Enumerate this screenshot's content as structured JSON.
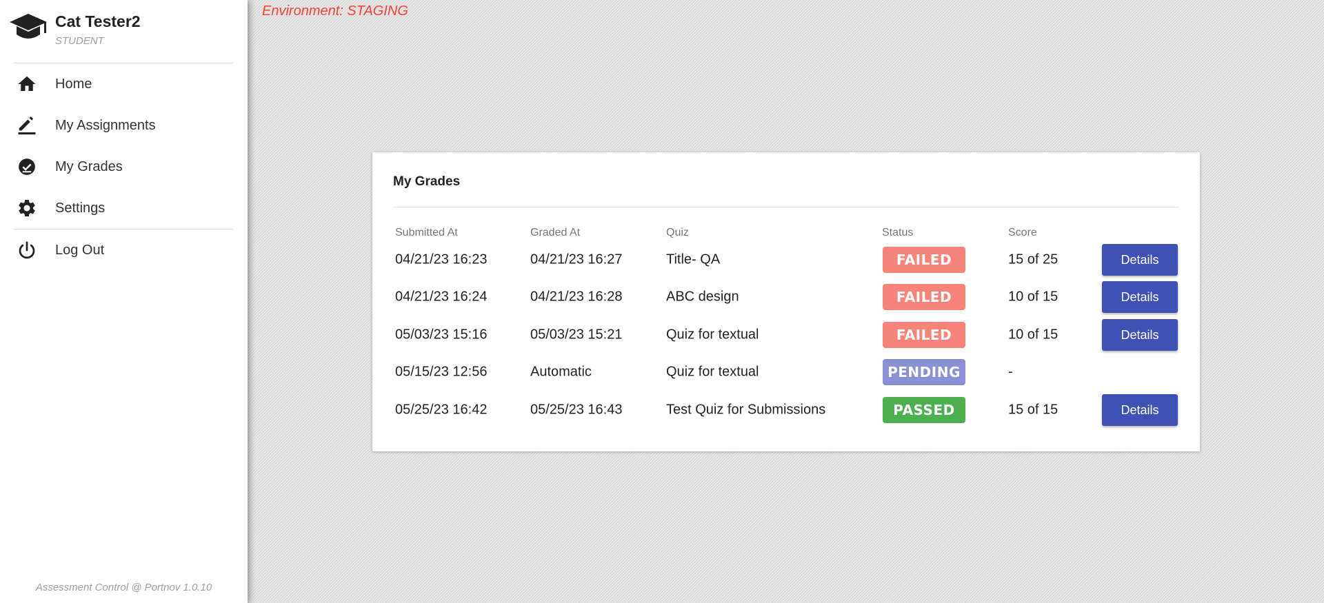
{
  "environment_label": "Environment: STAGING",
  "user": {
    "name": "Cat Tester2",
    "role": "STUDENT"
  },
  "nav": [
    {
      "label": "Home",
      "icon": "home-icon"
    },
    {
      "label": "My Assignments",
      "icon": "pencil-icon"
    },
    {
      "label": "My Grades",
      "icon": "check-circle-icon"
    },
    {
      "label": "Settings",
      "icon": "gear-icon"
    },
    {
      "label": "Log Out",
      "icon": "power-icon"
    }
  ],
  "footer": "Assessment Control @ Portnov 1.0.10",
  "grades": {
    "title": "My Grades",
    "headers": {
      "submitted": "Submitted At",
      "graded": "Graded At",
      "quiz": "Quiz",
      "status": "Status",
      "score": "Score"
    },
    "rows": [
      {
        "submitted": "04/21/23 16:23",
        "graded": "04/21/23 16:27",
        "quiz": "Title- QA",
        "status": "FAILED",
        "score": "15 of 25",
        "action": "Details"
      },
      {
        "submitted": "04/21/23 16:24",
        "graded": "04/21/23 16:28",
        "quiz": "ABC design",
        "status": "FAILED",
        "score": "10 of 15",
        "action": "Details"
      },
      {
        "submitted": "05/03/23 15:16",
        "graded": "05/03/23 15:21",
        "quiz": "Quiz for textual",
        "status": "FAILED",
        "score": "10 of 15",
        "action": "Details"
      },
      {
        "submitted": "05/15/23 12:56",
        "graded": "Automatic",
        "quiz": "Quiz for textual",
        "status": "PENDING",
        "score": "-",
        "action": ""
      },
      {
        "submitted": "05/25/23 16:42",
        "graded": "05/25/23 16:43",
        "quiz": "Test Quiz for Submissions",
        "status": "PASSED",
        "score": "15 of 15",
        "action": "Details"
      }
    ]
  },
  "colors": {
    "failed": "#f88379",
    "pending": "#8b8fd6",
    "passed": "#4caf50",
    "button": "#3f51b5",
    "environment": "#f44336"
  }
}
